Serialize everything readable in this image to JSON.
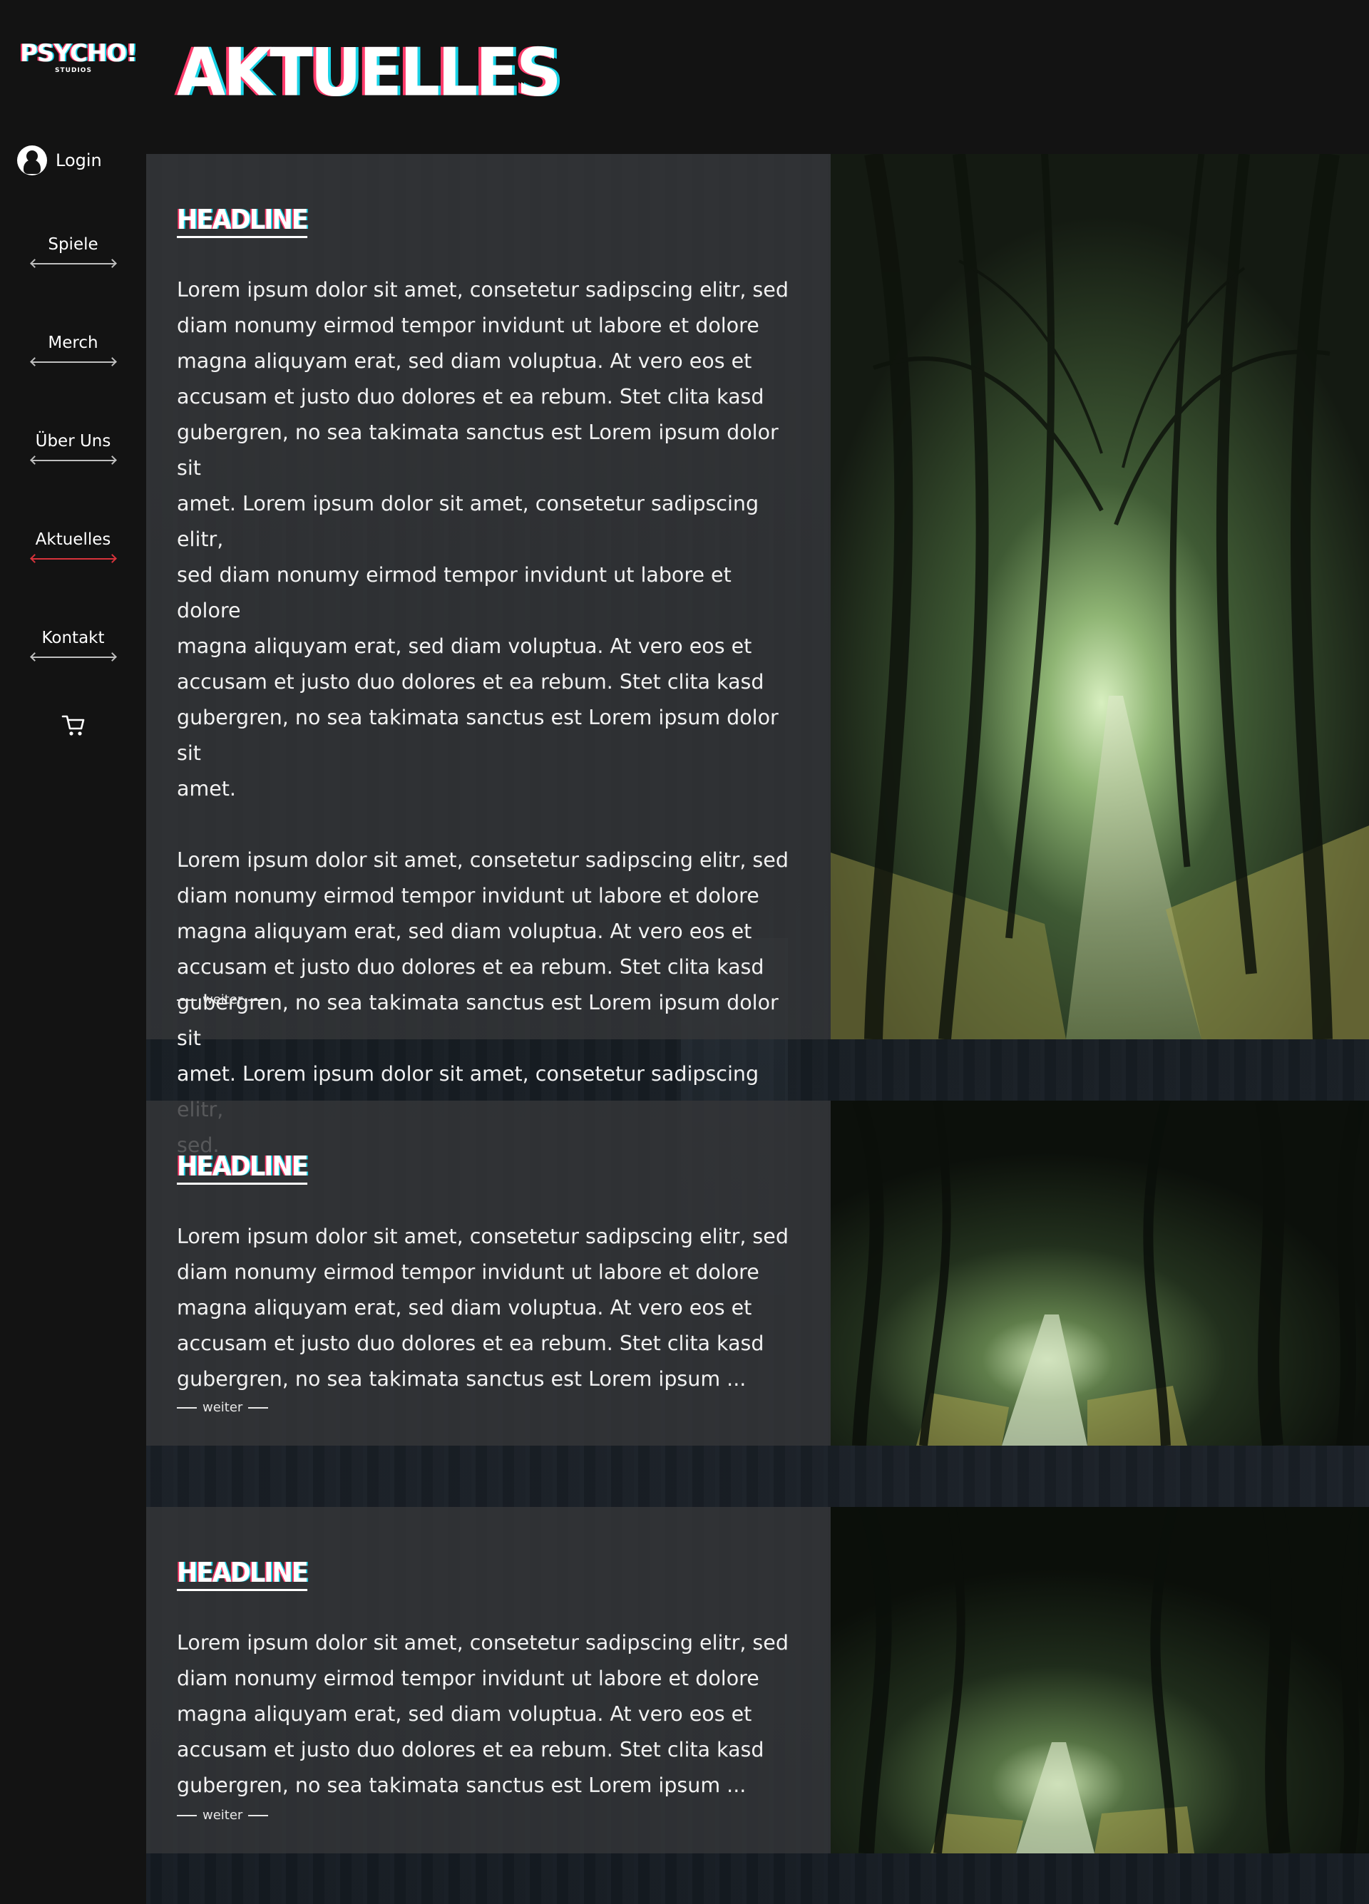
{
  "brand": {
    "name": "PSYCHO!",
    "sub": "STUDIOS"
  },
  "login": {
    "label": "Login"
  },
  "nav": {
    "items": [
      {
        "label": "Spiele"
      },
      {
        "label": "Merch"
      },
      {
        "label": "Über Uns"
      },
      {
        "label": "Aktuelles",
        "active": true
      },
      {
        "label": "Kontakt"
      }
    ]
  },
  "page": {
    "title": "AKTUELLES"
  },
  "articles": [
    {
      "headline": "HEADLINE",
      "paragraphs": [
        "Lorem ipsum dolor sit amet, consetetur sadipscing elitr, sed\ndiam nonumy eirmod tempor invidunt ut labore et dolore\nmagna aliquyam erat, sed diam voluptua. At vero eos et\naccusam et justo duo dolores et ea rebum. Stet clita kasd\ngubergren, no sea takimata sanctus est Lorem ipsum dolor sit\namet. Lorem ipsum dolor sit amet, consetetur sadipscing elitr,\nsed diam nonumy eirmod tempor invidunt ut labore et dolore\nmagna aliquyam erat, sed diam voluptua. At vero eos et\naccusam et justo duo dolores et ea rebum. Stet clita kasd\ngubergren, no sea takimata sanctus est Lorem ipsum dolor sit\namet.",
        "Lorem ipsum dolor sit amet, consetetur sadipscing elitr, sed\ndiam nonumy eirmod tempor invidunt ut labore et dolore\nmagna aliquyam erat, sed diam voluptua. At vero eos et\naccusam et justo duo dolores et ea rebum. Stet clita kasd\ngubergren, no sea takimata sanctus est Lorem ipsum dolor sit\namet. Lorem ipsum dolor sit amet, consetetur sadipscing elitr,\nsed."
      ],
      "more": "weiter"
    },
    {
      "headline": "HEADLINE",
      "paragraphs": [
        "Lorem ipsum dolor sit amet, consetetur sadipscing elitr, sed\ndiam nonumy eirmod tempor invidunt ut labore et dolore\nmagna aliquyam erat, sed diam voluptua. At vero eos et\naccusam et justo duo dolores et ea rebum. Stet clita kasd\ngubergren, no sea takimata sanctus est Lorem ipsum ..."
      ],
      "more": "weiter"
    },
    {
      "headline": "HEADLINE",
      "paragraphs": [
        "Lorem ipsum dolor sit amet, consetetur sadipscing elitr, sed\ndiam nonumy eirmod tempor invidunt ut labore et dolore\nmagna aliquyam erat, sed diam voluptua. At vero eos et\naccusam et justo duo dolores et ea rebum. Stet clita kasd\ngubergren, no sea takimata sanctus est Lorem ipsum ..."
      ],
      "more": "weiter"
    }
  ],
  "icons": {
    "login": "user-circle-icon",
    "cart": "shopping-cart-icon",
    "forest": "forest-path-image"
  },
  "colors": {
    "accent_red": "#d8333b",
    "glitch_pink": "#ff3b6b",
    "glitch_cyan": "#19d3e6",
    "background": "#131313"
  }
}
